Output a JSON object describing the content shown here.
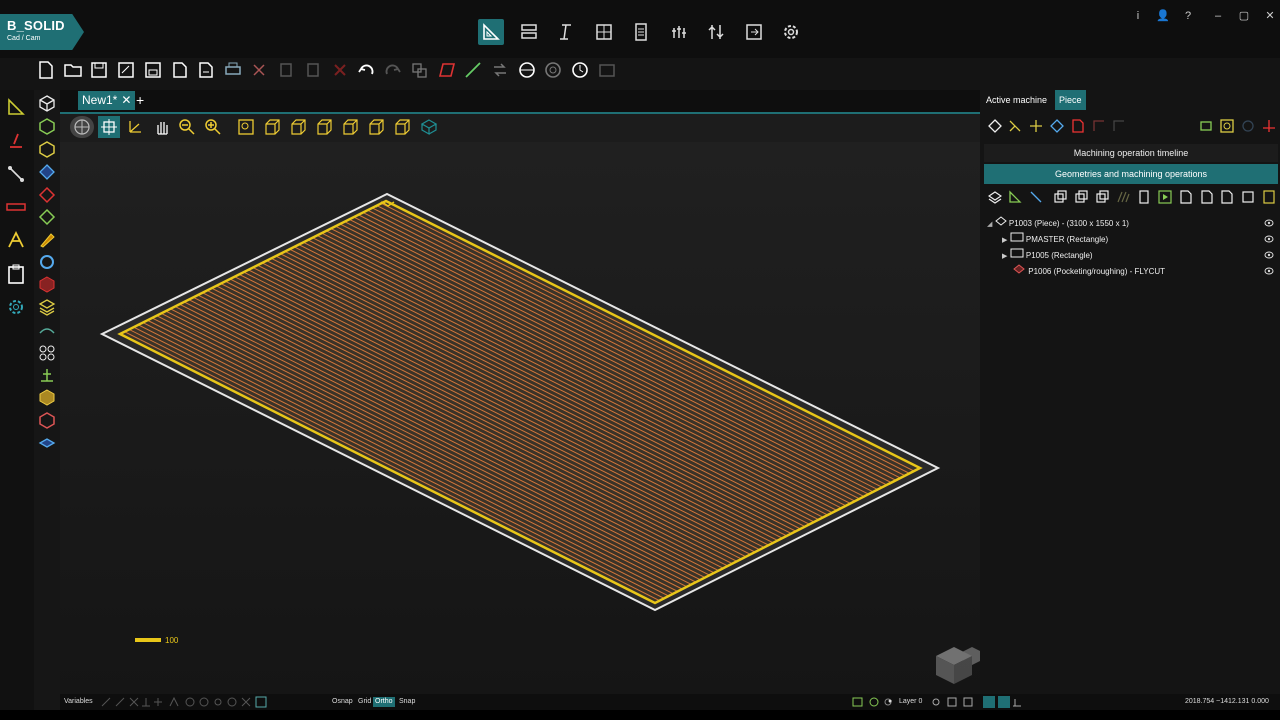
{
  "app": {
    "logo_title": "B_SOLID",
    "logo_subtitle": "Cad / Cam"
  },
  "window_controls": [
    "i",
    "👤",
    "?",
    "–",
    "▢",
    "✕"
  ],
  "tabs": {
    "document": "New1*",
    "close": "✕",
    "add": "+"
  },
  "right_panel": {
    "tabs": [
      "Active machine",
      "Piece"
    ],
    "active_tab": "Piece",
    "timeline_header": "Machining operation timeline",
    "geometries_header": "Geometries and machining operations",
    "tree": [
      {
        "label": "P1003 (Piece) - (3100 x 1550 x 1)",
        "expanded": true
      },
      {
        "label": "PMASTER (Rectangle)",
        "expanded": false
      },
      {
        "label": "P1005 (Rectangle)",
        "expanded": false
      },
      {
        "label": "P1006 (Pocketing/roughing) - FLYCUT",
        "expanded": false
      }
    ]
  },
  "viewport": {
    "scale_value": "100"
  },
  "status_bar": {
    "variables": "Variables",
    "osnap": "Osnap",
    "grid": "Grid",
    "ortho": "Ortho",
    "snap": "Snap",
    "layer": "Layer 0",
    "coords": "2018.754 ~1412.131 0.000"
  },
  "colors": {
    "accent": "#1f6f74",
    "toolpath": "#d4763a",
    "boundary": "#e8c619",
    "outline": "#e6e6e6"
  }
}
